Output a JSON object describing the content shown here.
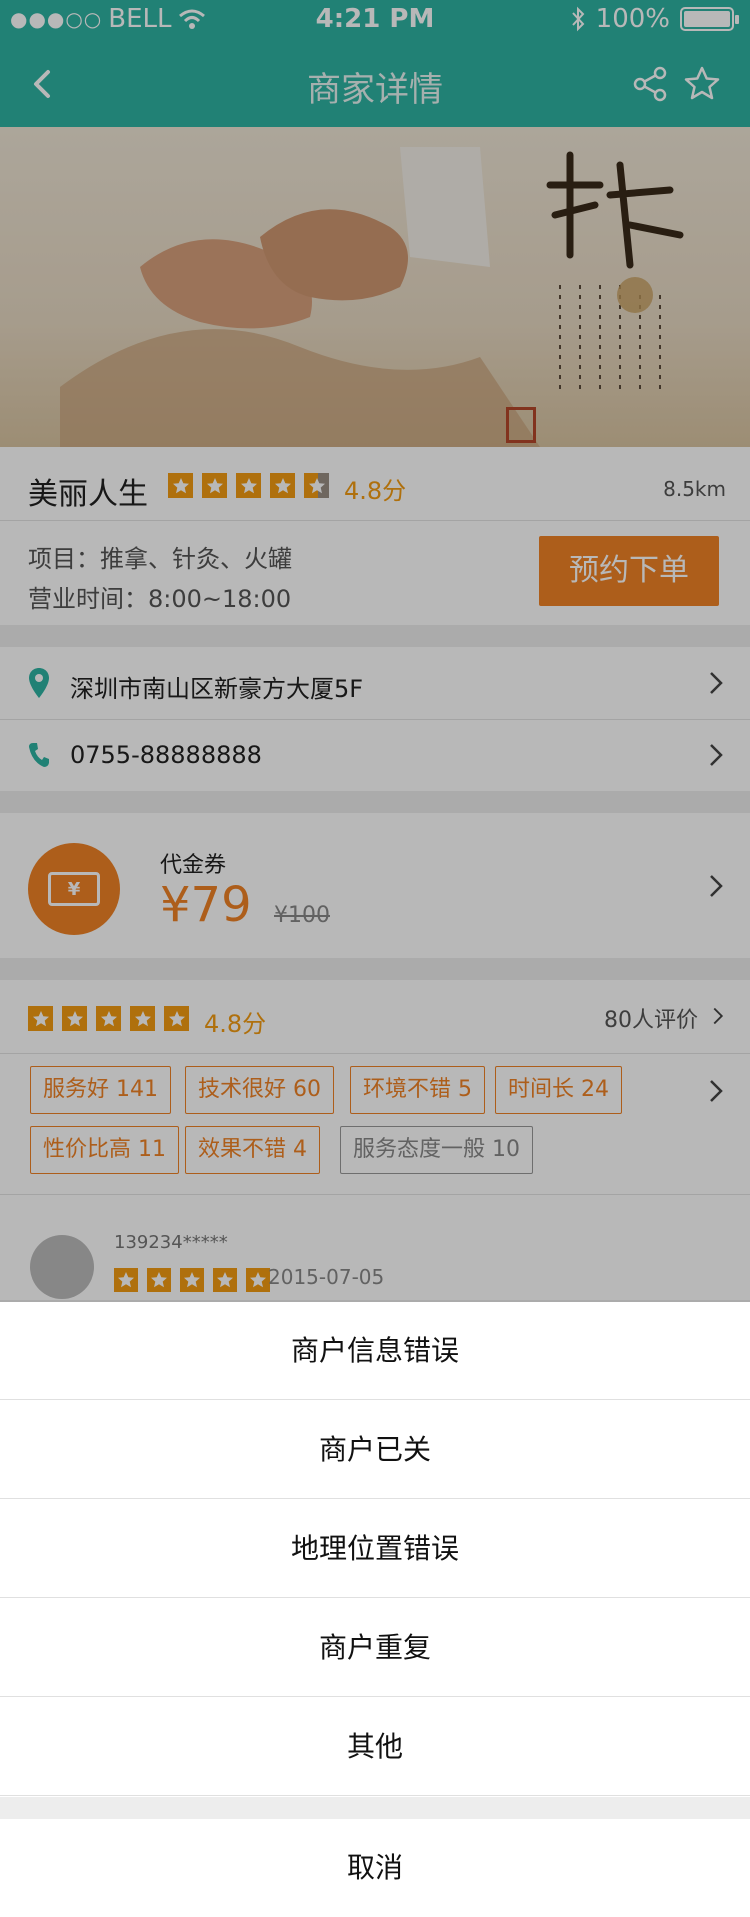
{
  "status": {
    "carrier": "BELL",
    "signal_dots": "●●●○○",
    "time": "4:21 PM",
    "battery": "100%"
  },
  "nav": {
    "title": "商家详情"
  },
  "shop": {
    "name": "美丽人生",
    "rating_text": "4.8分",
    "distance": "8.5km",
    "projects": "项目：推拿、针灸、火罐",
    "hours": "营业时间：8:00~18:00",
    "book_label": "预约下单"
  },
  "address": {
    "text": "深圳市南山区新豪方大厦5F",
    "phone": "0755-88888888"
  },
  "voucher": {
    "label": "代金券",
    "price": "¥79",
    "original": "¥100",
    "ticket_glyph": "¥"
  },
  "reviews": {
    "rating_text": "4.8分",
    "count_label": "80人评价",
    "tags": [
      {
        "label": "服务好 141"
      },
      {
        "label": "技术很好 60"
      },
      {
        "label": "环境不错 5"
      },
      {
        "label": "时间长 24"
      },
      {
        "label": "性价比高 11"
      },
      {
        "label": "效果不错 4"
      },
      {
        "label": "服务态度一般 10"
      }
    ],
    "first": {
      "user": "139234*****",
      "date": "2015-07-05"
    }
  },
  "action_sheet": {
    "items": [
      "商户信息错误",
      "商户已关",
      "地理位置错误",
      "商户重复",
      "其他"
    ],
    "cancel": "取消"
  },
  "colors": {
    "accent": "#f08326",
    "nav": "#2fb3a3",
    "star": "#f39c12"
  },
  "icons": [
    "back-icon",
    "share-icon",
    "star-outline-icon",
    "location-pin-icon",
    "phone-icon",
    "chevron-right-icon",
    "ticket-icon"
  ]
}
